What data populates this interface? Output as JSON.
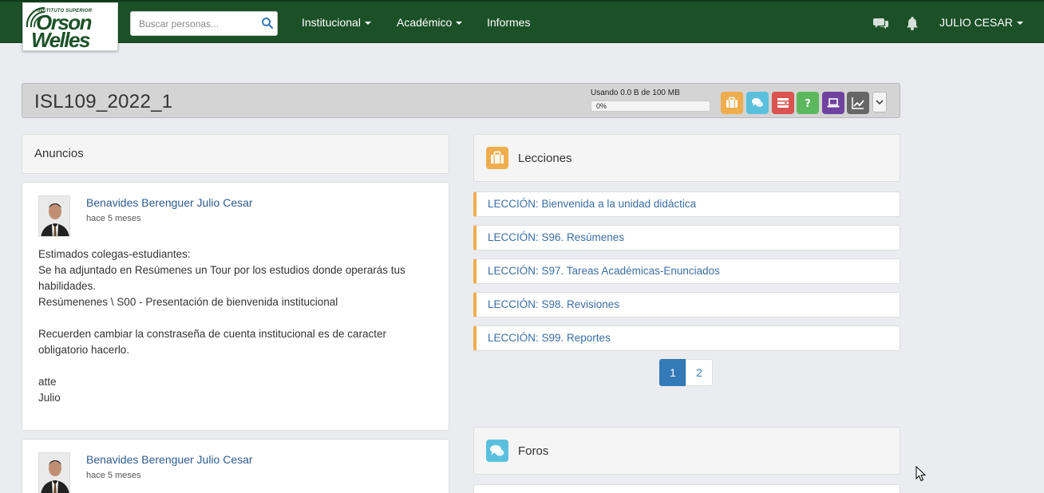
{
  "nav": {
    "logo_line1": "INSTITUTO SUPERIOR",
    "logo_line2": "Orson",
    "logo_line3": "Welles",
    "search_placeholder": "Buscar personas...",
    "menu": [
      "Institucional",
      "Académico",
      "Informes"
    ],
    "user_name": "JULIO CESAR",
    "icons": [
      "search-icon",
      "chat-icon",
      "bell-icon"
    ]
  },
  "course": {
    "title": "ISL109_2022_1",
    "storage_label": "Usando 0.0 B de 100 MB",
    "storage_percent": "0%",
    "storage_fraction": 0,
    "tools": [
      {
        "name": "lessons-button",
        "color": "#f0ad4e",
        "icon": "briefcase-icon"
      },
      {
        "name": "forums-button",
        "color": "#5bc0de",
        "icon": "chat-icon"
      },
      {
        "name": "tasks-button",
        "color": "#d9534f",
        "icon": "list-icon"
      },
      {
        "name": "quiz-button",
        "color": "#5cb85c",
        "icon": "question-icon"
      },
      {
        "name": "virtual-class-button",
        "color": "#6f42a0",
        "icon": "laptop-icon"
      },
      {
        "name": "reports-button",
        "color": "#666666",
        "icon": "chart-line-icon"
      }
    ]
  },
  "announcements": {
    "title": "Anuncios",
    "posts": [
      {
        "author": "Benavides Berenguer Julio Cesar",
        "time": "hace 5 meses",
        "lines": [
          "Estimados colegas-estudiantes:",
          "Se ha adjuntado en Resúmenes un Tour por los estudios donde operarás tus",
          "habilidades.",
          "Resúmenenes \\ S00 - Presentación de bienvenida institucional",
          "",
          "Recuerden cambiar la constraseña de cuenta institucional es de caracter",
          "obligatorio hacerlo.",
          "",
          "atte",
          "Julio"
        ]
      },
      {
        "author": "Benavides Berenguer Julio Cesar",
        "time": "hace 5 meses"
      }
    ]
  },
  "lessons": {
    "title": "Lecciones",
    "items": [
      "LECCIÓN: Bienvenida a la unidad didáctica",
      "LECCIÓN: S96. Resúmenes",
      "LECCIÓN: S97. Tareas Académicas-Enunciados",
      "LECCIÓN: S98. Revisiones",
      "LECCIÓN: S99. Reportes"
    ],
    "pages": [
      "1",
      "2"
    ],
    "active_page": "1"
  },
  "forums": {
    "title": "Foros"
  },
  "colors": {
    "navbar": "#1c5128",
    "accent_blue": "#337ab7",
    "lesson_border": "#f0ad4e",
    "link": "#3a6ea5"
  }
}
